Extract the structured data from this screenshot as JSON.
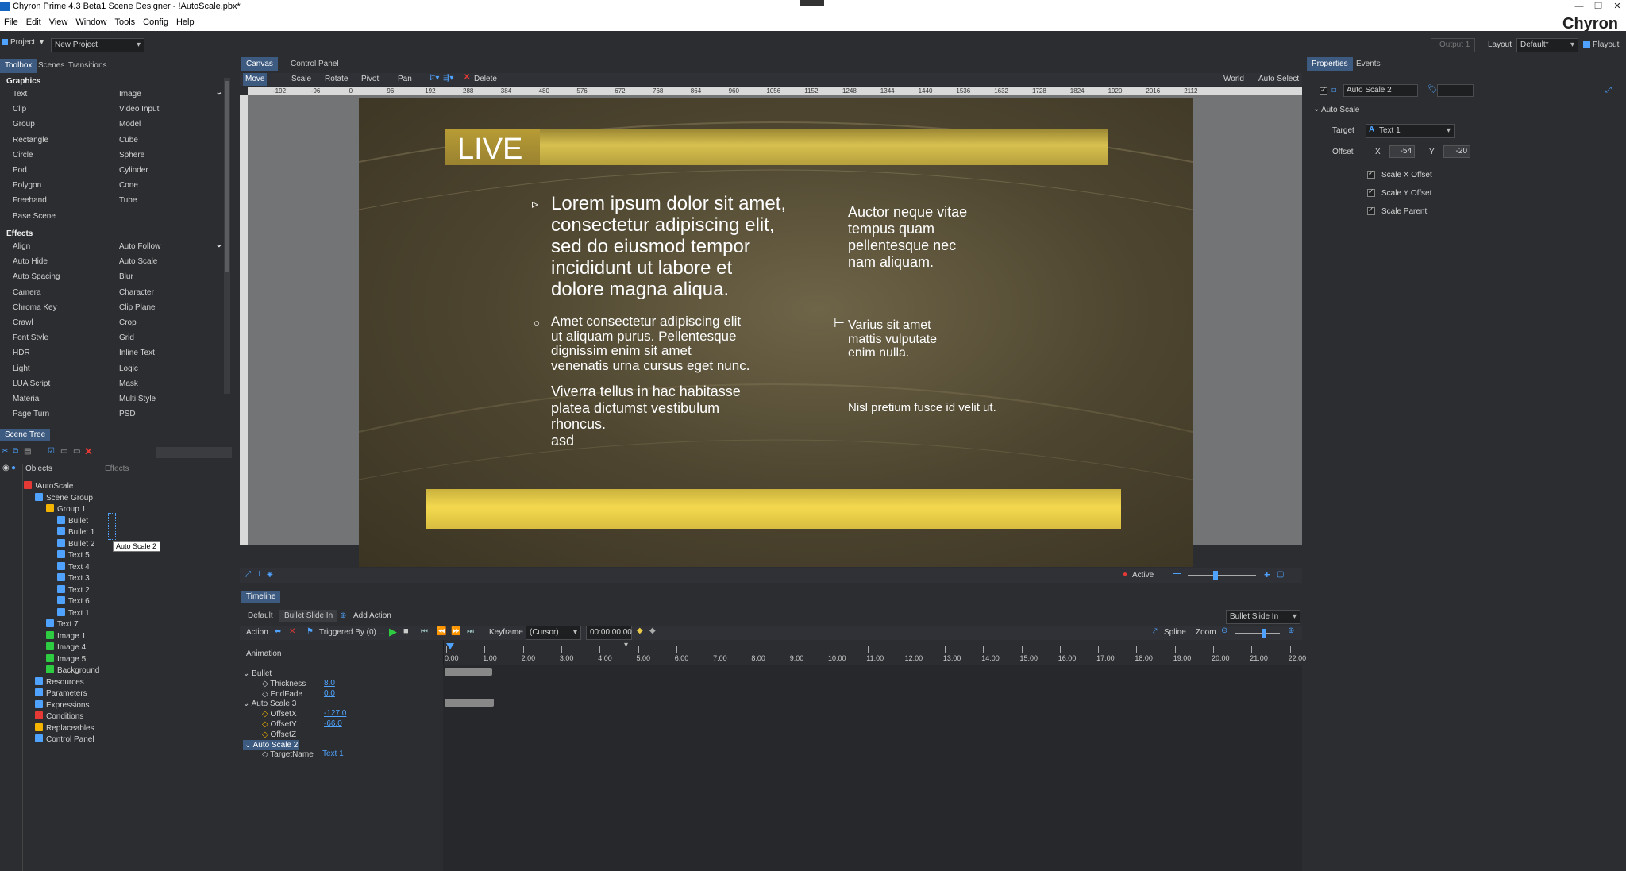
{
  "app": {
    "title": "Chyron Prime 4.3 Beta1 Scene Designer - !AutoScale.pbx*",
    "brand": "Chyron"
  },
  "menu": [
    "File",
    "Edit",
    "View",
    "Window",
    "Tools",
    "Config",
    "Help"
  ],
  "projectbar": {
    "project_label": "Project",
    "project_value": "New Project",
    "output_label": "Output 1",
    "layout_label": "Layout",
    "layout_value": "Default*",
    "playout_label": "Playout"
  },
  "left_tabs": [
    "Toolbox",
    "Scenes",
    "Transitions"
  ],
  "graphics": {
    "title": "Graphics",
    "col1": [
      "Text",
      "Clip",
      "Group",
      "Rectangle",
      "Circle",
      "Pod",
      "Polygon",
      "Freehand",
      "Base Scene"
    ],
    "col2": [
      "Image",
      "Video Input",
      "Model",
      "Cube",
      "Sphere",
      "Cylinder",
      "Cone",
      "Tube"
    ]
  },
  "effects": {
    "title": "Effects",
    "col1": [
      "Align",
      "Auto Hide",
      "Auto Spacing",
      "Camera",
      "Chroma Key",
      "Crawl",
      "Font Style",
      "HDR",
      "Light",
      "LUA Script",
      "Material",
      "Page Turn"
    ],
    "col2": [
      "Auto Follow",
      "Auto Scale",
      "Blur",
      "Character",
      "Clip Plane",
      "Crop",
      "Grid",
      "Inline Text",
      "Logic",
      "Mask",
      "Multi Style",
      "PSD"
    ]
  },
  "scene_tree": {
    "tab": "Scene Tree",
    "col_objects": "Objects",
    "col_effects": "Effects",
    "items": [
      "!AutoScale",
      "Scene Group",
      "Group 1",
      "Bullet",
      "Bullet 1",
      "Bullet 2",
      "Text 5",
      "Text 4",
      "Text 3",
      "Text 2",
      "Text 6",
      "Text 1",
      "Text 7",
      "Image 1",
      "Image 4",
      "Image 5",
      "Background",
      "Resources",
      "Parameters",
      "Expressions",
      "Conditions",
      "Replaceables",
      "Control Panel"
    ],
    "tooltip": "Auto Scale 2"
  },
  "canvas_tabs": [
    "Canvas",
    "Control Panel"
  ],
  "canvas_toolbar": {
    "move": "Move",
    "scale": "Scale",
    "rotate": "Rotate",
    "pivot": "Pivot",
    "pan": "Pan",
    "delete": "Delete",
    "world": "World",
    "auto_select": "Auto Select"
  },
  "ruler": [
    "-192",
    "-96",
    "0",
    "96",
    "192",
    "288",
    "384",
    "480",
    "576",
    "672",
    "768",
    "864",
    "960",
    "1056",
    "1152",
    "1248",
    "1344",
    "1440",
    "1536",
    "1632",
    "1728",
    "1824",
    "1920",
    "2016",
    "2112"
  ],
  "stage": {
    "live": "LIVE",
    "para1": [
      "Lorem ipsum dolor sit amet,",
      "consectetur adipiscing elit,",
      "sed do eiusmod tempor",
      "incididunt ut labore et",
      "dolore magna aliqua."
    ],
    "para2": [
      "Amet consectetur adipiscing elit",
      "ut aliquam purus. Pellentesque",
      "dignissim enim sit amet",
      "venenatis urna cursus eget nunc."
    ],
    "para3": [
      "Viverra tellus in hac habitasse",
      "platea dictumst vestibulum",
      "rhoncus.",
      "asd"
    ],
    "right1": [
      "Auctor neque vitae",
      "tempus quam",
      "pellentesque nec",
      "nam aliquam."
    ],
    "right2": [
      "Varius sit amet",
      "mattis vulputate",
      "enim nulla."
    ],
    "right3": "Nisl pretium fusce id velit ut.",
    "bullet1": "▹",
    "bullet2": "○",
    "bullet3": "⊢"
  },
  "canvas_status": {
    "active": "Active"
  },
  "timeline": {
    "tab": "Timeline",
    "tabs": [
      "Default",
      "Bullet Slide In"
    ],
    "add_action": "Add Action",
    "action_label": "Action",
    "triggered": "Triggered By (0) ...",
    "keyframe_label": "Keyframe",
    "cursor_value": "(Cursor)",
    "time_value": "00:00:00.00",
    "spline": "Spline",
    "zoom": "Zoom",
    "preset": "Bullet Slide In",
    "animation_label": "Animation",
    "ticks": [
      "0:00",
      "1:00",
      "2:00",
      "3:00",
      "4:00",
      "5:00",
      "6:00",
      "7:00",
      "8:00",
      "9:00",
      "10:00",
      "11:00",
      "12:00",
      "13:00",
      "14:00",
      "15:00",
      "16:00",
      "17:00",
      "18:00",
      "19:00",
      "20:00",
      "21:00",
      "22:00"
    ],
    "tracks": [
      {
        "name": "Bullet",
        "group": true
      },
      {
        "name": "Thickness",
        "value": "8.0"
      },
      {
        "name": "EndFade",
        "value": "0.0"
      },
      {
        "name": "Auto Scale 3",
        "group": true
      },
      {
        "name": "OffsetX",
        "value": "-127.0"
      },
      {
        "name": "OffsetY",
        "value": "-66.0"
      },
      {
        "name": "OffsetZ",
        "value": ""
      },
      {
        "name": "Auto Scale 2",
        "group": true
      },
      {
        "name": "TargetName",
        "value": "Text 1"
      }
    ]
  },
  "properties": {
    "tabs": [
      "Properties",
      "Events"
    ],
    "name": "Auto Scale 2",
    "section": "Auto Scale",
    "target_label": "Target",
    "target_value": "Text 1",
    "offset_label": "Offset",
    "x_label": "X",
    "x_value": "-54",
    "y_label": "Y",
    "y_value": "-20",
    "checks": [
      "Scale X Offset",
      "Scale Y Offset",
      "Scale Parent"
    ]
  },
  "colors": {
    "accent": "#3d5a80",
    "gold": "#e8c94a",
    "bg": "#2b2d30",
    "link": "#4fa3ff"
  }
}
